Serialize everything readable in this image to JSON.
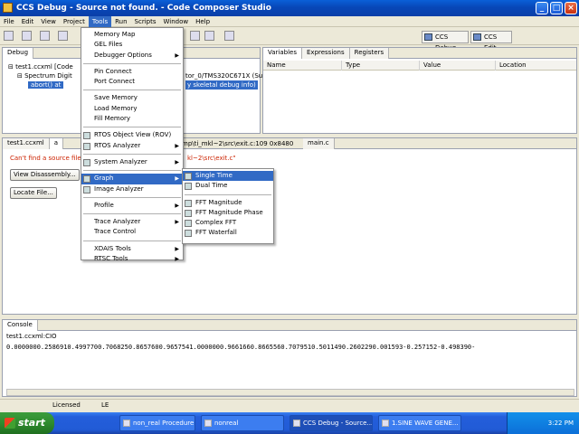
{
  "window": {
    "title": "CCS Debug - Source not found. - Code Composer Studio"
  },
  "menubar": [
    "File",
    "Edit",
    "View",
    "Project",
    "Tools",
    "Run",
    "Scripts",
    "Window",
    "Help"
  ],
  "perspectives": [
    "CCS Debug",
    "CCS Edit"
  ],
  "debug_view": {
    "tab": "Debug",
    "rows": [
      "test1.ccxml [Code",
      "Spectrum Digit",
      "abort() at"
    ],
    "row_tail_1": "tor_0/TMS320C671X (Suspe",
    "row_tail_2": "y skeletal debug info)"
  },
  "variables_view": {
    "tabs": [
      "Variables",
      "Expressions",
      "Registers"
    ],
    "columns": [
      "Name",
      "Type",
      "Value",
      "Location"
    ]
  },
  "editor": {
    "tabs": [
      "test1.ccxml",
      "a",
      "main.c"
    ],
    "tab_path": "mp\\ti_mkl~2\\src\\exit.c:109 0x8480",
    "message_start": "Can't find a source file at",
    "message_end": "kl~2\\src\\exit.c\"",
    "view_disassembly": "View Disassembly...",
    "locate_file": "Locate File..."
  },
  "tools_menu": [
    {
      "label": "Memory Map"
    },
    {
      "label": "GEL Files"
    },
    {
      "label": "Debugger Options",
      "arrow": true
    },
    {
      "sep": true
    },
    {
      "label": "Pin Connect"
    },
    {
      "label": "Port Connect"
    },
    {
      "sep": true
    },
    {
      "label": "Save Memory"
    },
    {
      "label": "Load Memory"
    },
    {
      "label": "Fill Memory"
    },
    {
      "sep": true
    },
    {
      "label": "RTOS Object View (ROV)",
      "icon": true
    },
    {
      "label": "RTOS Analyzer",
      "arrow": true,
      "icon": true
    },
    {
      "sep": true
    },
    {
      "label": "System Analyzer",
      "arrow": true,
      "icon": true
    },
    {
      "sep": true
    },
    {
      "label": "Graph",
      "arrow": true,
      "icon": true,
      "selected": true
    },
    {
      "label": "Image Analyzer",
      "icon": true
    },
    {
      "sep": true
    },
    {
      "label": "Profile",
      "arrow": true
    },
    {
      "sep": true
    },
    {
      "label": "Trace Analyzer",
      "arrow": true
    },
    {
      "label": "Trace Control"
    },
    {
      "sep": true
    },
    {
      "label": "XDAIS Tools",
      "arrow": true
    },
    {
      "label": "RTSC Tools",
      "arrow": true
    }
  ],
  "graph_submenu": [
    {
      "label": "Single Time",
      "selected": true
    },
    {
      "label": "Dual Time"
    },
    {
      "sep": true
    },
    {
      "label": "FFT Magnitude"
    },
    {
      "label": "FFT Magnitude Phase"
    },
    {
      "label": "Complex FFT"
    },
    {
      "label": "FFT Waterfall"
    }
  ],
  "console": {
    "tab": "Console",
    "session": "test1.ccxml:CIO",
    "output": "0.0000000.2586910.4997700.7068250.8657600.9657541.0000000.9661660.8665560.7079510.5011490.2602290.001593-0.257152-0.498390-"
  },
  "status": {
    "licensed": "Licensed",
    "mode": "LE"
  },
  "taskbar": {
    "start": "start",
    "tasks": [
      "non_real Procedure...",
      "nonreal",
      "CCS Debug - Source...",
      "1.SINE WAVE GENE..."
    ],
    "clock": "3:22 PM"
  },
  "colors": {
    "highlight": "#316ac5",
    "error_text": "#cc2200",
    "xp_blue": "#245edb"
  }
}
